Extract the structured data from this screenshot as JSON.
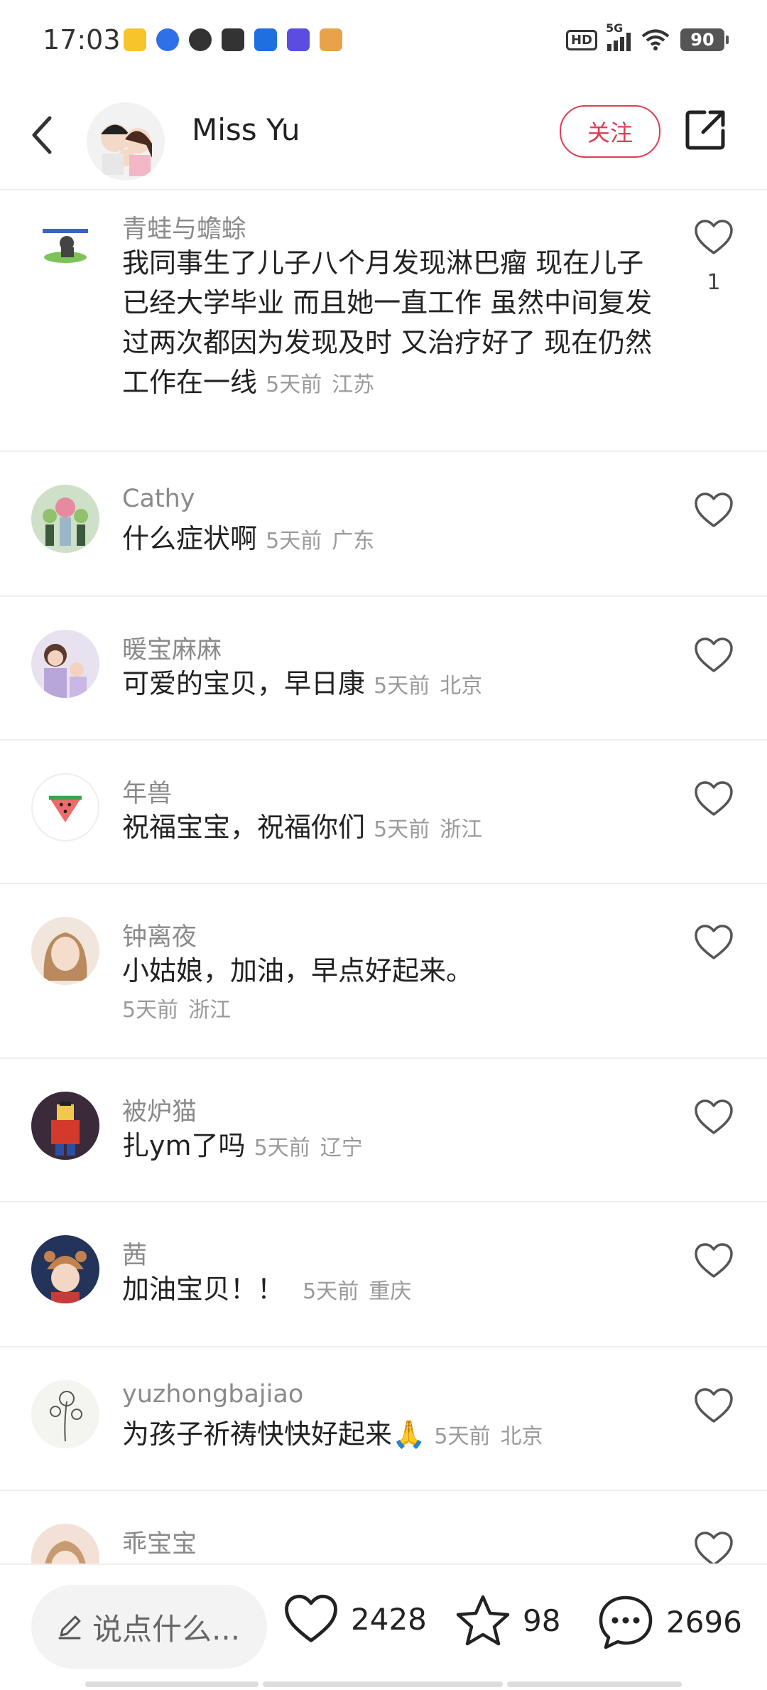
{
  "status_bar": {
    "time": "17:03",
    "hd": "HD",
    "network": "5G",
    "battery": "90"
  },
  "header": {
    "user_name": "Miss Yu",
    "follow_label": "关注"
  },
  "comments": [
    {
      "user": "青蛙与蟾蜍",
      "text": "我同事生了儿子八个月发现淋巴瘤 现在儿子已经大学毕业 而且她一直工作 虽然中间复发过两次都因为发现及时 又治疗好了 现在仍然工作在一线",
      "time": "5天前",
      "location": "江苏",
      "likes": "1"
    },
    {
      "user": "Cathy",
      "text": "什么症状啊",
      "time": "5天前",
      "location": "广东"
    },
    {
      "user": "暖宝麻麻",
      "text": "可爱的宝贝，早日康",
      "time": "5天前",
      "location": "北京"
    },
    {
      "user": "年兽",
      "text": "祝福宝宝，祝福你们",
      "time": "5天前",
      "location": "浙江"
    },
    {
      "user": "钟离夜",
      "text": "小姑娘，加油，早点好起来。",
      "time": "5天前",
      "location": "浙江"
    },
    {
      "user": "被炉猫",
      "text": "扎ym了吗",
      "time": "5天前",
      "location": "辽宁"
    },
    {
      "user": "茜",
      "text": "加油宝贝！！",
      "time": "5天前",
      "location": "重庆"
    },
    {
      "user": "yuzhongbajiao",
      "text": "为孩子祈祷快快好起来🙏",
      "time": "5天前",
      "location": "北京"
    },
    {
      "user": "乖宝宝",
      "text": "",
      "time": "",
      "location": ""
    }
  ],
  "bottom_bar": {
    "input_placeholder": "说点什么...",
    "likes": "2428",
    "favorites": "98",
    "comments": "2696"
  },
  "colors": {
    "accent": "#e03c55",
    "muted_text": "#8a8a8a",
    "divider": "#efefef"
  }
}
